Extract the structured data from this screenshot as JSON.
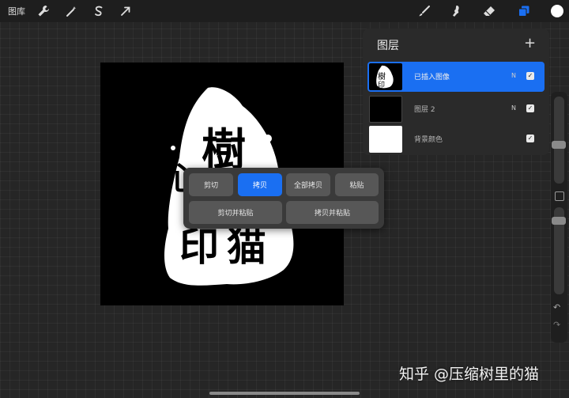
{
  "topbar": {
    "gallery_label": "图库",
    "left_tools": [
      "wrench-icon",
      "magic-wand-icon",
      "selection-s-icon",
      "transform-arrow-icon"
    ],
    "right_tools": [
      "brush-icon",
      "smudge-icon",
      "eraser-icon",
      "layers-icon",
      "color-icon"
    ],
    "accent": "#1a6ff2",
    "current_color": "#ffffff"
  },
  "canvas": {
    "artwork_text": "心樹印猫"
  },
  "popup": {
    "cut": "剪切",
    "copy": "拷贝",
    "copy_all": "全部拷贝",
    "paste": "粘贴",
    "cut_and_paste": "剪切并粘贴",
    "copy_and_paste": "拷贝并粘贴",
    "selected": "拷贝"
  },
  "layers": {
    "title": "图层",
    "add": "+",
    "items": [
      {
        "name": "已插入图像",
        "blend": "N",
        "visible": "✓",
        "active": true
      },
      {
        "name": "图层 2",
        "blend": "N",
        "visible": "✓",
        "active": false
      },
      {
        "name": "背景颜色",
        "blend": "",
        "visible": "✓",
        "active": false
      }
    ]
  },
  "sidebar": {
    "undo": "↶",
    "redo": "↷"
  },
  "watermark": "知乎 @压缩树里的猫"
}
